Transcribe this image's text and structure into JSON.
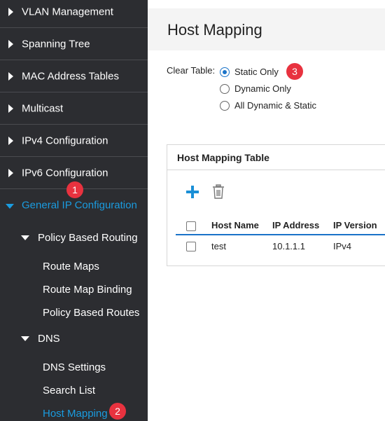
{
  "sidebar": {
    "top_items": [
      {
        "label": "VLAN Management"
      },
      {
        "label": "Spanning Tree"
      },
      {
        "label": "MAC Address Tables"
      },
      {
        "label": "Multicast"
      },
      {
        "label": "IPv4 Configuration"
      },
      {
        "label": "IPv6 Configuration"
      },
      {
        "label": "General IP Configuration"
      }
    ],
    "sub_items": [
      {
        "label": "Policy Based Routing"
      },
      {
        "label": "DNS"
      }
    ],
    "leaves": [
      {
        "label": "Route Maps"
      },
      {
        "label": "Route Map Binding"
      },
      {
        "label": "Policy Based Routes"
      },
      {
        "label": "DNS Settings"
      },
      {
        "label": "Search List"
      },
      {
        "label": "Host Mapping"
      }
    ]
  },
  "badges": [
    "1",
    "2",
    "3"
  ],
  "main": {
    "title": "Host Mapping",
    "clear_table": {
      "label": "Clear Table:",
      "options": [
        "Static Only",
        "Dynamic Only",
        "All Dynamic & Static"
      ],
      "selected": "Static Only"
    },
    "table": {
      "title": "Host Mapping Table",
      "columns": [
        "Host Name",
        "IP Address",
        "IP Version"
      ],
      "rows": [
        {
          "host_name": "test",
          "ip_address": "10.1.1.1",
          "ip_version": "IPv4"
        }
      ]
    }
  },
  "colors": {
    "sidebar_bg": "#2c2d31",
    "accent": "#1a9ce0",
    "badge": "#e8323f"
  }
}
